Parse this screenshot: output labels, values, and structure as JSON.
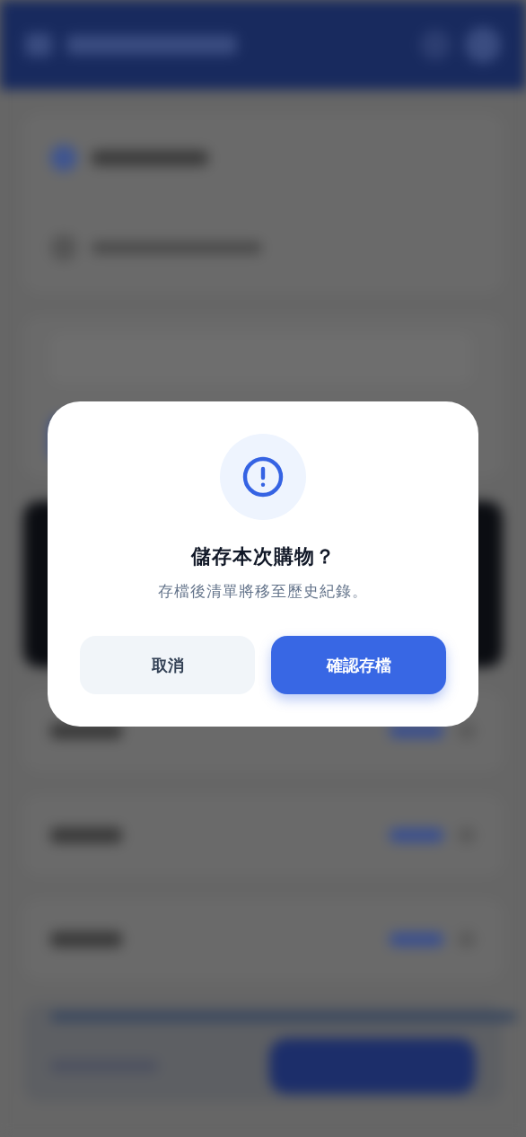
{
  "dialog": {
    "title": "儲存本次購物？",
    "message": "存檔後清單將移至歷史紀錄。",
    "buttons": [
      {
        "label": "取消",
        "kind": "secondary"
      },
      {
        "label": "確認存檔",
        "kind": "primary"
      }
    ]
  }
}
